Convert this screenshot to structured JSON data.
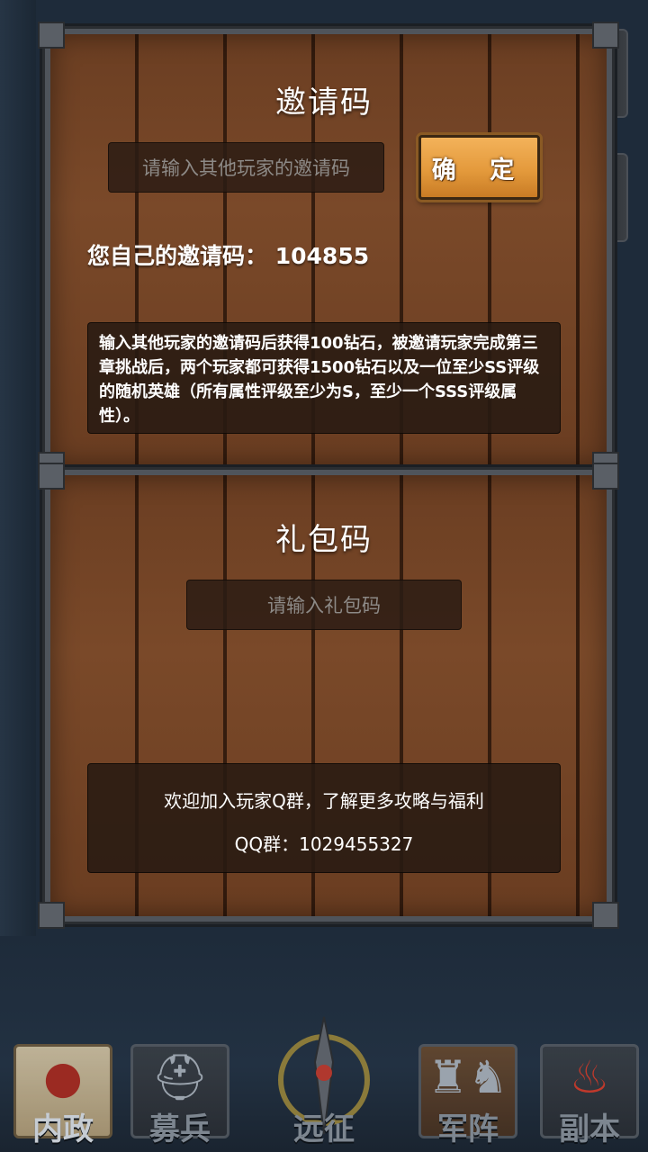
{
  "invite": {
    "title": "邀请码",
    "input_placeholder": "请输入其他玩家的邀请码",
    "confirm_label": "确 定",
    "own_code_label": "您自己的邀请码：",
    "own_code_value": "104855",
    "description": "输入其他玩家的邀请码后获得100钻石，被邀请玩家完成第三章挑战后，两个玩家都可获得1500钻石以及一位至少SS评级的随机英雄（所有属性评级至少为S，至少一个SSS评级属性）。"
  },
  "gift": {
    "title": "礼包码",
    "input_placeholder": "请输入礼包码",
    "qq_welcome": "欢迎加入玩家Q群，了解更多攻略与福利",
    "qq_group": "QQ群：1029455327"
  },
  "nav": {
    "items": [
      {
        "label": "内政",
        "icon": "scroll-seal-icon",
        "active": true
      },
      {
        "label": "募兵",
        "icon": "helmets-icon",
        "active": false
      },
      {
        "label": "远征",
        "icon": "sword-emblem-icon",
        "active": false
      },
      {
        "label": "军阵",
        "icon": "chess-pieces-icon",
        "active": false
      },
      {
        "label": "副本",
        "icon": "flame-tower-icon",
        "active": false
      }
    ]
  },
  "colors": {
    "wood": "#7a4929",
    "confirm": "#e49a3c",
    "frame": "#4f545b",
    "background": "#1e2b3a"
  }
}
